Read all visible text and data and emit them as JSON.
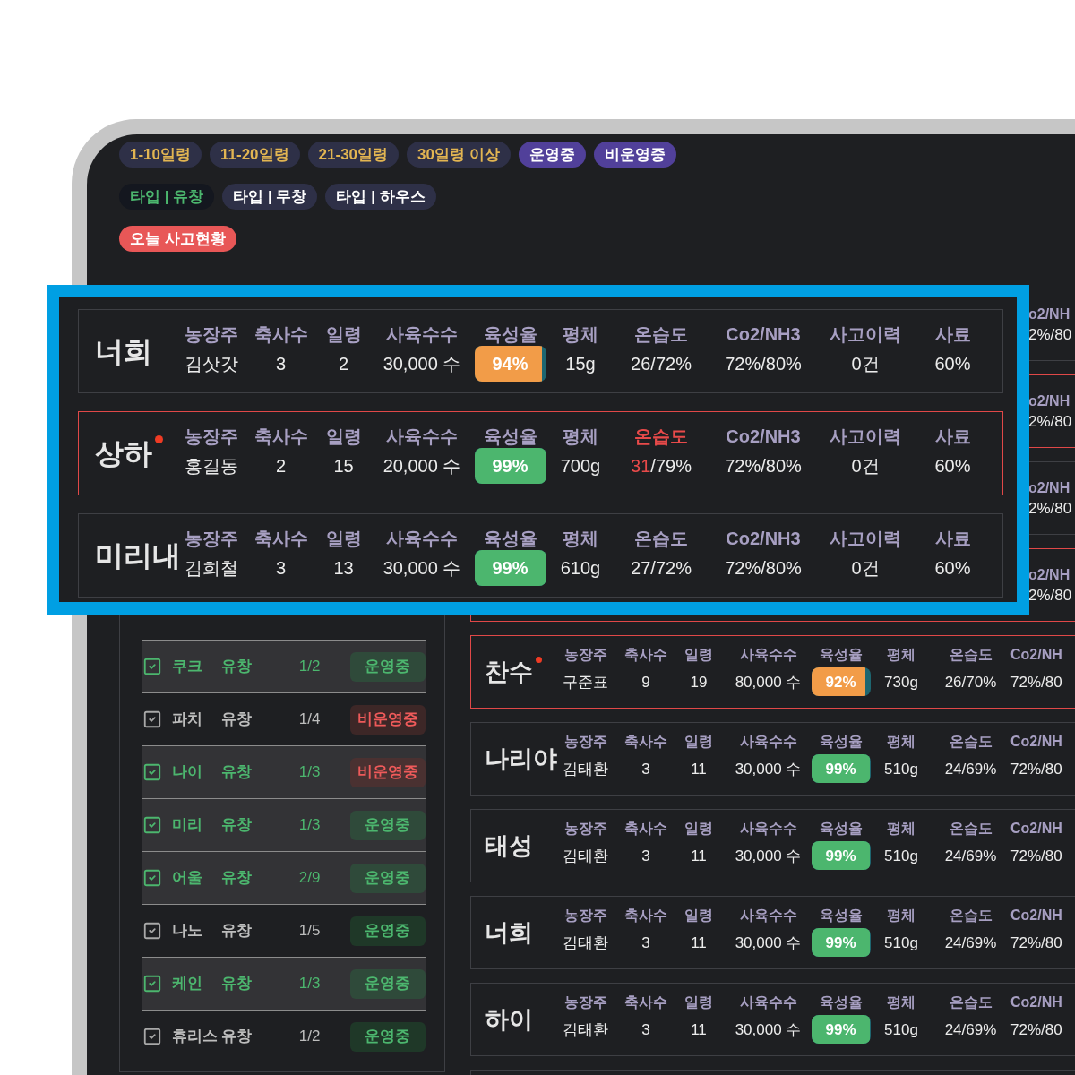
{
  "tag_rows": [
    {
      "tags": [
        {
          "kind": "age",
          "label": "1-10일령"
        },
        {
          "kind": "age",
          "label": "11-20일령"
        },
        {
          "kind": "age",
          "label": "21-30일령"
        },
        {
          "kind": "age",
          "label": "30일령 이상"
        },
        {
          "kind": "status",
          "label": "운영중"
        },
        {
          "kind": "status",
          "label": "비운영중"
        }
      ]
    },
    {
      "tags": [
        {
          "kind": "type",
          "label": "타입 | 유창",
          "selected": true
        },
        {
          "kind": "type",
          "label": "타입 | 무창",
          "selected": false
        },
        {
          "kind": "type",
          "label": "타입 | 하우스",
          "selected": false
        }
      ]
    },
    {
      "tags": [
        {
          "kind": "alert",
          "label": "오늘 사고현황"
        }
      ]
    }
  ],
  "farm_list": {
    "rows": [
      {
        "checked": true,
        "name": "쿠크",
        "type": "유창",
        "ratio": "1/2",
        "status": "운영중",
        "running": true
      },
      {
        "checked": false,
        "name": "파치",
        "type": "유창",
        "ratio": "1/4",
        "status": "비운영중",
        "running": false
      },
      {
        "checked": true,
        "name": "나이",
        "type": "유창",
        "ratio": "1/3",
        "status": "비운영중",
        "running": false
      },
      {
        "checked": true,
        "name": "미리",
        "type": "유창",
        "ratio": "1/3",
        "status": "운영중",
        "running": true
      },
      {
        "checked": true,
        "name": "어울",
        "type": "유창",
        "ratio": "2/9",
        "status": "운영중",
        "running": true
      },
      {
        "checked": false,
        "name": "나노",
        "type": "유창",
        "ratio": "1/5",
        "status": "운영중",
        "running": true
      },
      {
        "checked": true,
        "name": "케인",
        "type": "유창",
        "ratio": "1/3",
        "status": "운영중",
        "running": true
      },
      {
        "checked": false,
        "name": "휴리스",
        "type": "유창",
        "ratio": "1/2",
        "status": "운영중",
        "running": true
      }
    ]
  },
  "farm_cards": [
    {
      "kind": "partial",
      "alert": false,
      "fields": [
        {
          "kind": "text",
          "label": "o2/NH",
          "value": "2%/80"
        }
      ]
    },
    {
      "kind": "partial",
      "alert": true,
      "fields": [
        {
          "kind": "text",
          "label": "o2/NH",
          "value": "2%/80"
        }
      ]
    },
    {
      "kind": "partial",
      "alert": false,
      "fields": [
        {
          "kind": "text",
          "label": "o2/NH",
          "value": "2%/80"
        }
      ]
    },
    {
      "kind": "partial",
      "alert": true,
      "fields": [
        {
          "kind": "text",
          "label": "o2/NH",
          "value": "2%/80"
        }
      ]
    },
    {
      "kind": "full",
      "name": "찬수",
      "alert": true,
      "fields": [
        {
          "kind": "text",
          "label": "농장주",
          "value": "구준표"
        },
        {
          "kind": "text",
          "label": "축사수",
          "value": "9"
        },
        {
          "kind": "text",
          "label": "일령",
          "value": "19"
        },
        {
          "kind": "text",
          "label": "사육수수",
          "value": "80,000 수"
        },
        {
          "kind": "rate",
          "label": "육성율",
          "value": "92%",
          "level": 0.92,
          "warning": true
        },
        {
          "kind": "text",
          "label": "평체",
          "value": "730g"
        },
        {
          "kind": "climate",
          "label": "온습도",
          "temp": "26",
          "humidity": "/70%",
          "alert": false
        },
        {
          "kind": "text",
          "label": "Co2/NH",
          "value": "72%/80"
        }
      ]
    },
    {
      "kind": "full",
      "name": "나리야",
      "alert": false,
      "fields": [
        {
          "kind": "text",
          "label": "농장주",
          "value": "김태환"
        },
        {
          "kind": "text",
          "label": "축사수",
          "value": "3"
        },
        {
          "kind": "text",
          "label": "일령",
          "value": "11"
        },
        {
          "kind": "text",
          "label": "사육수수",
          "value": "30,000 수"
        },
        {
          "kind": "rate",
          "label": "육성율",
          "value": "99%",
          "level": 0.99,
          "warning": false
        },
        {
          "kind": "text",
          "label": "평체",
          "value": "510g"
        },
        {
          "kind": "climate",
          "label": "온습도",
          "temp": "24",
          "humidity": "/69%",
          "alert": false
        },
        {
          "kind": "text",
          "label": "Co2/NH",
          "value": "72%/80"
        }
      ]
    },
    {
      "kind": "full",
      "name": "태성",
      "alert": false,
      "fields": [
        {
          "kind": "text",
          "label": "농장주",
          "value": "김태환"
        },
        {
          "kind": "text",
          "label": "축사수",
          "value": "3"
        },
        {
          "kind": "text",
          "label": "일령",
          "value": "11"
        },
        {
          "kind": "text",
          "label": "사육수수",
          "value": "30,000 수"
        },
        {
          "kind": "rate",
          "label": "육성율",
          "value": "99%",
          "level": 0.99,
          "warning": false
        },
        {
          "kind": "text",
          "label": "평체",
          "value": "510g"
        },
        {
          "kind": "climate",
          "label": "온습도",
          "temp": "24",
          "humidity": "/69%",
          "alert": false
        },
        {
          "kind": "text",
          "label": "Co2/NH",
          "value": "72%/80"
        }
      ]
    },
    {
      "kind": "full",
      "name": "너희",
      "alert": false,
      "fields": [
        {
          "kind": "text",
          "label": "농장주",
          "value": "김태환"
        },
        {
          "kind": "text",
          "label": "축사수",
          "value": "3"
        },
        {
          "kind": "text",
          "label": "일령",
          "value": "11"
        },
        {
          "kind": "text",
          "label": "사육수수",
          "value": "30,000 수"
        },
        {
          "kind": "rate",
          "label": "육성율",
          "value": "99%",
          "level": 0.99,
          "warning": false
        },
        {
          "kind": "text",
          "label": "평체",
          "value": "510g"
        },
        {
          "kind": "climate",
          "label": "온습도",
          "temp": "24",
          "humidity": "/69%",
          "alert": false
        },
        {
          "kind": "text",
          "label": "Co2/NH",
          "value": "72%/80"
        }
      ]
    },
    {
      "kind": "full",
      "name": "하이",
      "alert": false,
      "fields": [
        {
          "kind": "text",
          "label": "농장주",
          "value": "김태환"
        },
        {
          "kind": "text",
          "label": "축사수",
          "value": "3"
        },
        {
          "kind": "text",
          "label": "일령",
          "value": "11"
        },
        {
          "kind": "text",
          "label": "사육수수",
          "value": "30,000 수"
        },
        {
          "kind": "rate",
          "label": "육성율",
          "value": "99%",
          "level": 0.99,
          "warning": false
        },
        {
          "kind": "text",
          "label": "평체",
          "value": "510g"
        },
        {
          "kind": "climate",
          "label": "온습도",
          "temp": "24",
          "humidity": "/69%",
          "alert": false
        },
        {
          "kind": "text",
          "label": "Co2/NH",
          "value": "72%/80"
        }
      ]
    }
  ],
  "callout": {
    "cards": [
      {
        "kind": "full",
        "name": "너희",
        "alert": false,
        "fields": [
          {
            "kind": "text",
            "label": "농장주",
            "value": "김삿갓"
          },
          {
            "kind": "text",
            "label": "축사수",
            "value": "3"
          },
          {
            "kind": "text",
            "label": "일령",
            "value": "2"
          },
          {
            "kind": "text",
            "label": "사육수수",
            "value": "30,000 수"
          },
          {
            "kind": "rate",
            "label": "육성율",
            "value": "94%",
            "level": 0.94,
            "warning": true
          },
          {
            "kind": "text",
            "label": "평체",
            "value": "15g"
          },
          {
            "kind": "climate",
            "label": "온습도",
            "temp": "26",
            "humidity": "/72%",
            "alert": false
          },
          {
            "kind": "text",
            "label": "Co2/NH3",
            "value": "72%/80%"
          },
          {
            "kind": "text",
            "label": "사고이력",
            "value": "0건"
          },
          {
            "kind": "text",
            "label": "사료",
            "value": "60%"
          }
        ]
      },
      {
        "kind": "full",
        "name": "상하",
        "alert": true,
        "fields": [
          {
            "kind": "text",
            "label": "농장주",
            "value": "홍길동"
          },
          {
            "kind": "text",
            "label": "축사수",
            "value": "2"
          },
          {
            "kind": "text",
            "label": "일령",
            "value": "15"
          },
          {
            "kind": "text",
            "label": "사육수수",
            "value": "20,000 수"
          },
          {
            "kind": "rate",
            "label": "육성율",
            "value": "99%",
            "level": 0.99,
            "warning": false
          },
          {
            "kind": "text",
            "label": "평체",
            "value": "700g"
          },
          {
            "kind": "climate",
            "label": "온습도",
            "temp": "31",
            "humidity": "/79%",
            "alert": true
          },
          {
            "kind": "text",
            "label": "Co2/NH3",
            "value": "72%/80%"
          },
          {
            "kind": "text",
            "label": "사고이력",
            "value": "0건"
          },
          {
            "kind": "text",
            "label": "사료",
            "value": "60%"
          }
        ]
      },
      {
        "kind": "full",
        "name": "미리내",
        "alert": false,
        "fields": [
          {
            "kind": "text",
            "label": "농장주",
            "value": "김희철"
          },
          {
            "kind": "text",
            "label": "축사수",
            "value": "3"
          },
          {
            "kind": "text",
            "label": "일령",
            "value": "13"
          },
          {
            "kind": "text",
            "label": "사육수수",
            "value": "30,000 수"
          },
          {
            "kind": "rate",
            "label": "육성율",
            "value": "99%",
            "level": 0.99,
            "warning": false
          },
          {
            "kind": "text",
            "label": "평체",
            "value": "610g"
          },
          {
            "kind": "climate",
            "label": "온습도",
            "temp": "27",
            "humidity": "/72%",
            "alert": false
          },
          {
            "kind": "text",
            "label": "Co2/NH3",
            "value": "72%/80%"
          },
          {
            "kind": "text",
            "label": "사고이력",
            "value": "0건"
          },
          {
            "kind": "text",
            "label": "사료",
            "value": "60%"
          }
        ]
      }
    ]
  }
}
